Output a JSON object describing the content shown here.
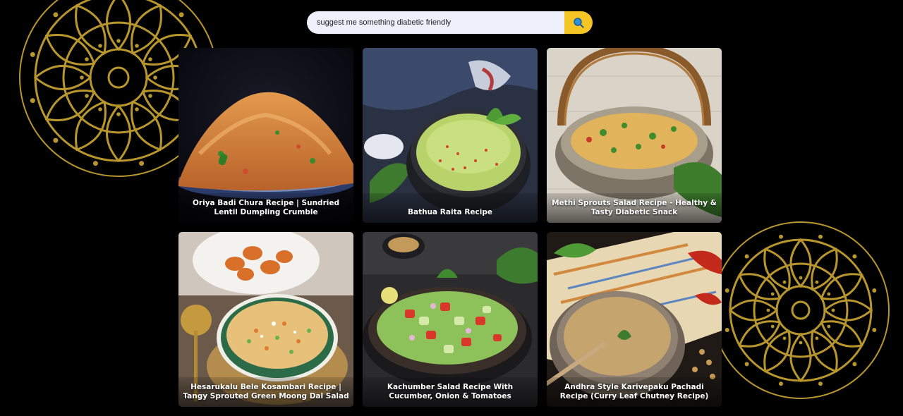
{
  "search": {
    "value": "suggest me something diabetic friendly",
    "button_icon": "search-icon"
  },
  "decorations": {
    "mandala_color": "#b8962e"
  },
  "colors": {
    "background": "#000000",
    "search_button": "#f5c526",
    "search_field": "#eef0fb"
  },
  "recipes": [
    {
      "title": "Oriya Badi Chura Recipe | Sundried Lentil Dumpling Crumble"
    },
    {
      "title": "Bathua Raita Recipe"
    },
    {
      "title": "Methi Sprouts Salad Recipe - Healthy & Tasty Diabetic Snack"
    },
    {
      "title": "Hesarukalu Bele Kosambari Recipe | Tangy Sprouted Green Moong Dal Salad"
    },
    {
      "title": "Kachumber Salad Recipe With Cucumber, Onion & Tomatoes"
    },
    {
      "title": "Andhra Style Karivepaku Pachadi Recipe (Curry Leaf Chutney Recipe)"
    }
  ]
}
